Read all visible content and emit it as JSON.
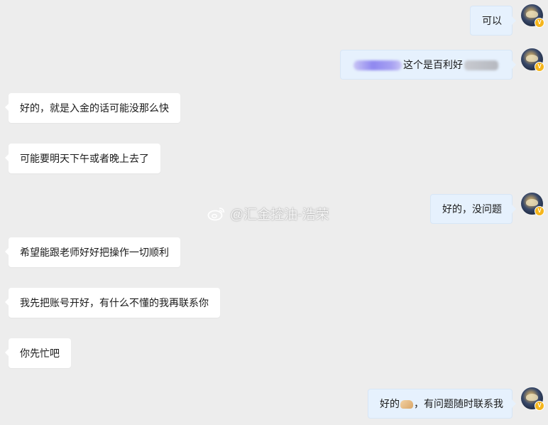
{
  "messages": [
    {
      "side": "out",
      "text": "可以"
    },
    {
      "side": "out",
      "text_visible": "这个是百利好",
      "redacted": true
    },
    {
      "side": "in",
      "text": "好的，就是入金的话可能没那么快"
    },
    {
      "side": "in",
      "text": "可能要明天下午或者晚上去了"
    },
    {
      "side": "out",
      "text": "好的，没问题"
    },
    {
      "side": "in",
      "text": "希望能跟老师好好把操作一切顺利"
    },
    {
      "side": "in",
      "text": "我先把账号开好，有什么不懂的我再联系你"
    },
    {
      "side": "in",
      "text": "你先忙吧"
    },
    {
      "side": "out",
      "text_before_emoji": "好的",
      "emoji": "handshake-emoji",
      "text_after_emoji": "，有问题随时联系我"
    }
  ],
  "avatar": {
    "badge": "V",
    "badge_color": "#f5b51b"
  },
  "watermark": {
    "text": "@汇金控油-浩荣"
  },
  "colors": {
    "background": "#ededed",
    "incoming_bubble": "#ffffff",
    "outgoing_bubble": "#e6f1fd"
  }
}
